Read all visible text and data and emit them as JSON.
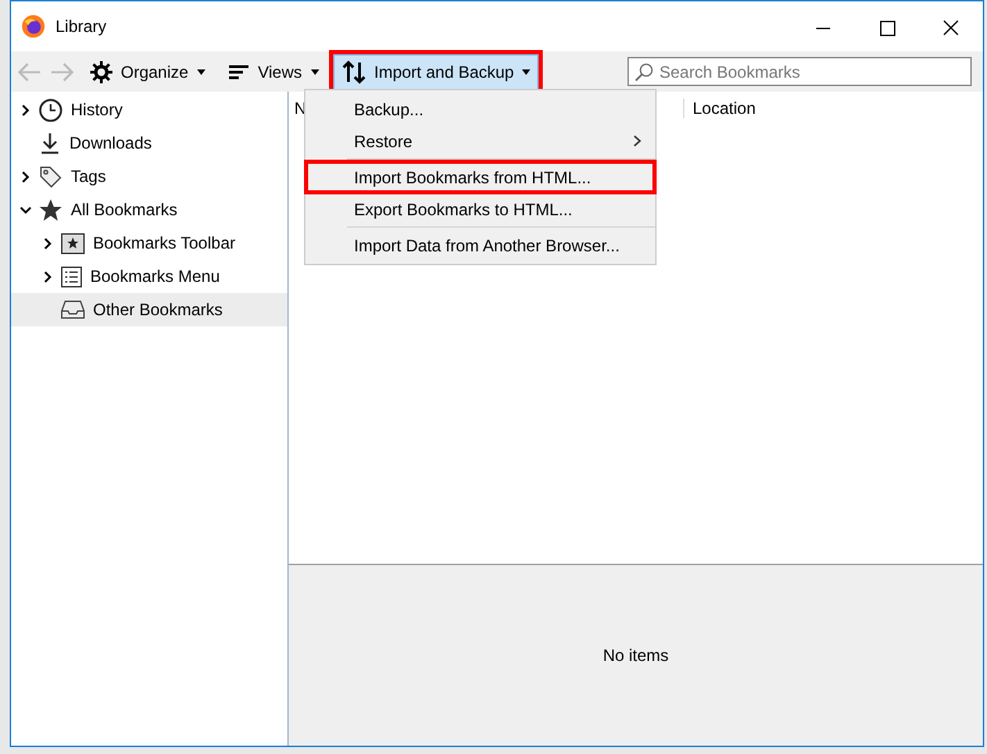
{
  "window": {
    "title": "Library"
  },
  "toolbar": {
    "buttons": [
      {
        "kind": "organize",
        "label": "Organize",
        "open": false,
        "highlighted": false
      },
      {
        "kind": "views",
        "label": "Views",
        "open": false,
        "highlighted": false
      },
      {
        "kind": "import",
        "label": "Import and Backup",
        "open": true,
        "highlighted": true
      }
    ],
    "search": {
      "placeholder": "Search Bookmarks"
    }
  },
  "sidebar": {
    "items": [
      {
        "kind": "history",
        "label": "History",
        "expanded": false,
        "selected": false
      },
      {
        "kind": "downloads",
        "label": "Downloads",
        "selected": false
      },
      {
        "kind": "tags",
        "label": "Tags",
        "expanded": false,
        "selected": false
      },
      {
        "kind": "star",
        "label": "All Bookmarks",
        "expanded": true,
        "selected": false,
        "children": [
          {
            "kind": "toolbar",
            "label": "Bookmarks Toolbar",
            "expanded": false,
            "selected": false
          },
          {
            "kind": "menu",
            "label": "Bookmarks Menu",
            "expanded": false,
            "selected": false
          },
          {
            "kind": "other",
            "label": "Other Bookmarks",
            "selected": true
          }
        ]
      }
    ]
  },
  "table": {
    "columns": [
      {
        "label": "N"
      },
      {
        "label": "Location"
      }
    ]
  },
  "menu": {
    "items": [
      {
        "kind": "item",
        "label": "Backup...",
        "submenu": false,
        "highlighted": false
      },
      {
        "kind": "item",
        "label": "Restore",
        "submenu": true,
        "highlighted": false
      },
      {
        "kind": "separator"
      },
      {
        "kind": "item",
        "label": "Import Bookmarks from HTML...",
        "submenu": false,
        "highlighted": true
      },
      {
        "kind": "item",
        "label": "Export Bookmarks to HTML...",
        "submenu": false,
        "highlighted": false
      },
      {
        "kind": "separator"
      },
      {
        "kind": "item",
        "label": "Import Data from Another Browser...",
        "submenu": false,
        "highlighted": false
      }
    ]
  },
  "details": {
    "message": "No items"
  }
}
